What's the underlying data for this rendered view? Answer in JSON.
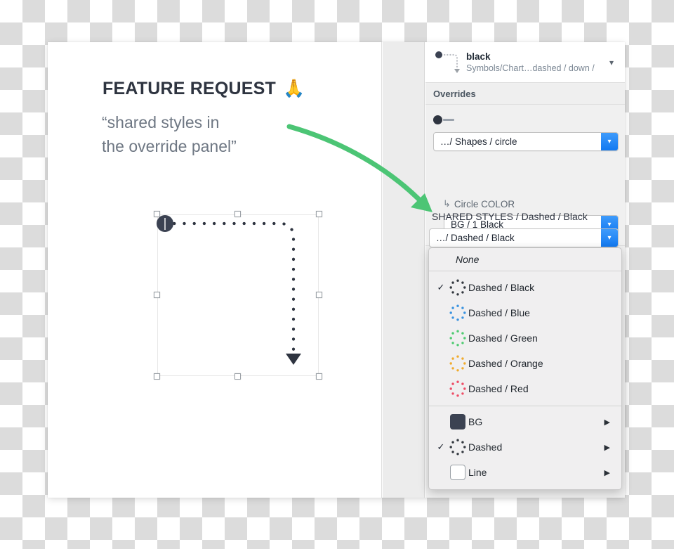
{
  "canvas": {
    "headline": "FEATURE REQUEST",
    "emoji": "🙏",
    "quote_line1": "“shared styles in",
    "quote_line2": "the override panel”",
    "selection_name": "dashed-path-shape"
  },
  "panel": {
    "symbol": {
      "name": "black",
      "path": "Symbols/Chart…dashed / down /",
      "chevron": "chevron-down"
    },
    "section_label": "Overrides",
    "override_shape": {
      "value": "…/ Shapes / circle",
      "sub_label": "Circle COLOR",
      "hook": "↳",
      "color_value": "BG / 1 Black"
    },
    "shared_styles": {
      "title": "SHARED STYLES / Dashed / Black",
      "value": "…/ Dashed / Black"
    }
  },
  "dropdown": {
    "none_label": "None",
    "items": [
      {
        "label": "Dashed / Black",
        "color": "#33383f",
        "checked": true
      },
      {
        "label": "Dashed / Blue",
        "color": "#3a93e0",
        "checked": false
      },
      {
        "label": "Dashed / Green",
        "color": "#4ecb71",
        "checked": false
      },
      {
        "label": "Dashed / Orange",
        "color": "#f0ab2e",
        "checked": false
      },
      {
        "label": "Dashed / Red",
        "color": "#ee4e67",
        "checked": false
      }
    ],
    "groups": [
      {
        "label": "BG",
        "swatch": "filled-square",
        "color": "#3b4252",
        "checked": false,
        "submenu_arrow": "▶"
      },
      {
        "label": "Dashed",
        "swatch": "dotted-circle",
        "color": "#33383f",
        "checked": true,
        "submenu_arrow": "▶"
      },
      {
        "label": "Line",
        "swatch": "outline-square",
        "color": "#ffffff",
        "checked": false,
        "submenu_arrow": "▶"
      }
    ],
    "check_glyph": "✓"
  },
  "colors": {
    "accent_blue": "#1279f1",
    "arrow_green": "#4cc575",
    "panel_bg": "#f0f0f0",
    "card_bg": "#ffffff"
  }
}
